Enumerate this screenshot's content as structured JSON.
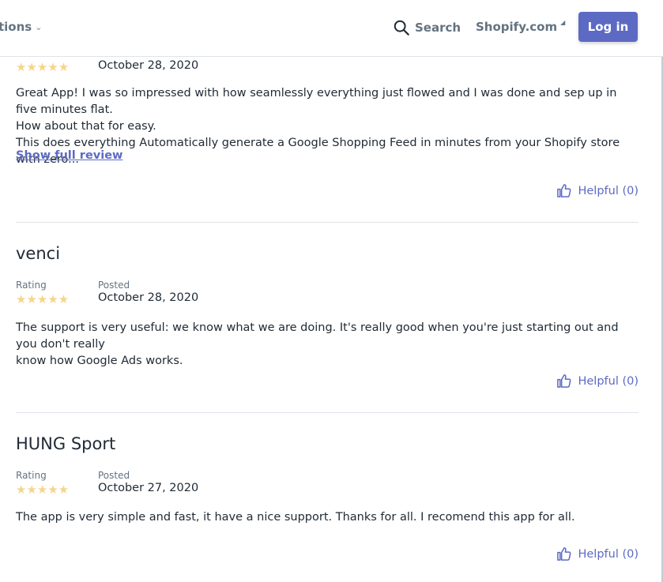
{
  "header": {
    "nav_left_label": "tions",
    "search_label": "Search",
    "shopify_label": "Shopify.com",
    "login_label": "Log in"
  },
  "reviews": [
    {
      "stars": "★★★★★",
      "date": "October 28, 2020",
      "lines": [
        "Great App! I was so impressed with how seamlessly everything just flowed and I was done and sep up in five minutes flat.",
        "How about that for easy.",
        "This does everything Automatically generate a Google Shopping Feed in minutes from your Shopify store with zero..."
      ],
      "show_full": "Show full review",
      "helpful": "Helpful (0)"
    },
    {
      "name": "venci",
      "rating_label": "Rating",
      "posted_label": "Posted",
      "stars": "★★★★★",
      "date": "October 28, 2020",
      "lines": [
        "The support is very useful: we know what we are doing. It's really good when you're just starting out and you don't really",
        "know how Google Ads works."
      ],
      "helpful": "Helpful (0)"
    },
    {
      "name": "HUNG Sport",
      "rating_label": "Rating",
      "posted_label": "Posted",
      "stars": "★★★★★",
      "date": "October 27, 2020",
      "lines": [
        "The app is very simple and fast, it have a nice support. Thanks for all. I recomend this app for all."
      ],
      "helpful": "Helpful (0)"
    }
  ]
}
